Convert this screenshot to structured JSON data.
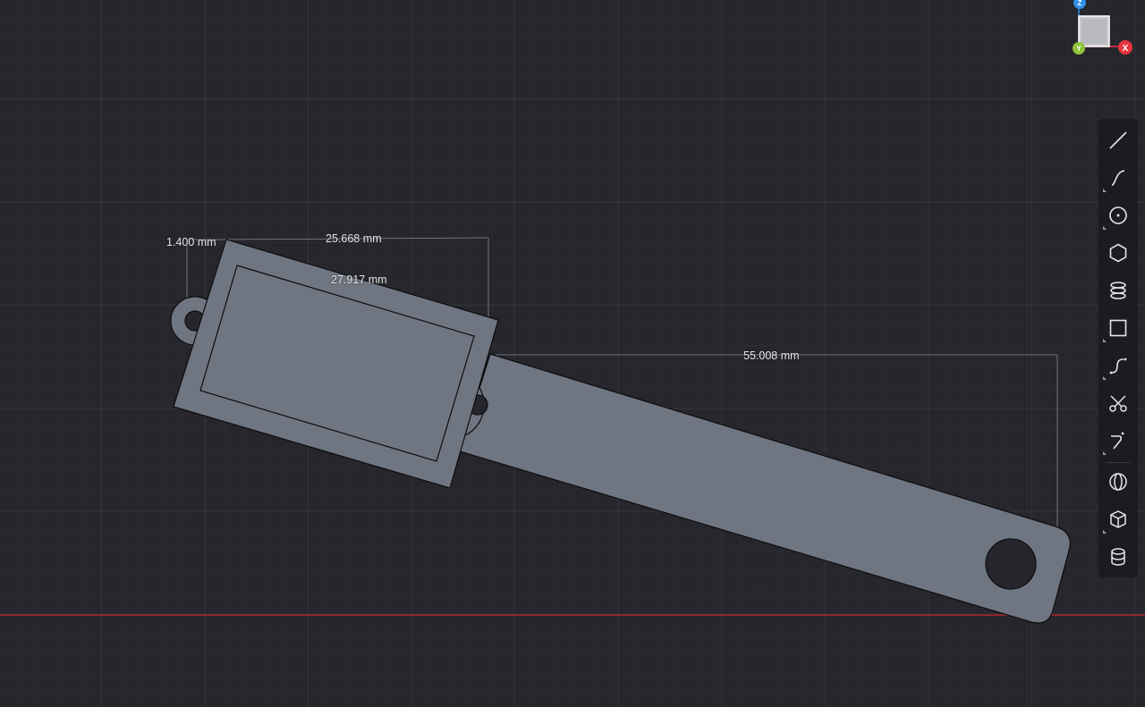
{
  "canvas": {
    "background": "#26262c",
    "grid_minor_color": "#2f2f36",
    "grid_major_color": "#3d3d45",
    "x_axis_color": "#b02a30"
  },
  "dimensions": {
    "d1": "1.400 mm",
    "d2": "25.668 mm",
    "d3": "27.917 mm",
    "d4": "55.008 mm"
  },
  "part": {
    "fill": "#6f7681",
    "stroke": "#0d0d10"
  },
  "viewcube": {
    "z_label": "Z",
    "x_label": "X",
    "y_label": "Y",
    "z_color": "#2f8fe8",
    "x_color": "#e8343f",
    "y_color": "#8fc23a"
  },
  "toolbar": {
    "tools": [
      {
        "name": "line-tool",
        "icon": "line-icon"
      },
      {
        "name": "spline-tool",
        "icon": "spline-icon"
      },
      {
        "name": "circle-tool",
        "icon": "circle-icon"
      },
      {
        "name": "polygon-tool",
        "icon": "hexagon-icon"
      },
      {
        "name": "coil-tool",
        "icon": "coil-icon"
      },
      {
        "name": "rectangle-tool",
        "icon": "rectangle-icon"
      },
      {
        "name": "curve-tool",
        "icon": "curve-icon"
      },
      {
        "name": "trim-tool",
        "icon": "scissors-icon"
      },
      {
        "name": "fillet-tool",
        "icon": "fillet-icon"
      },
      {
        "name": "sphere-tool",
        "icon": "sphere-icon"
      },
      {
        "name": "box-tool",
        "icon": "box-icon"
      },
      {
        "name": "cylinder-tool",
        "icon": "cylinder-icon"
      }
    ]
  }
}
